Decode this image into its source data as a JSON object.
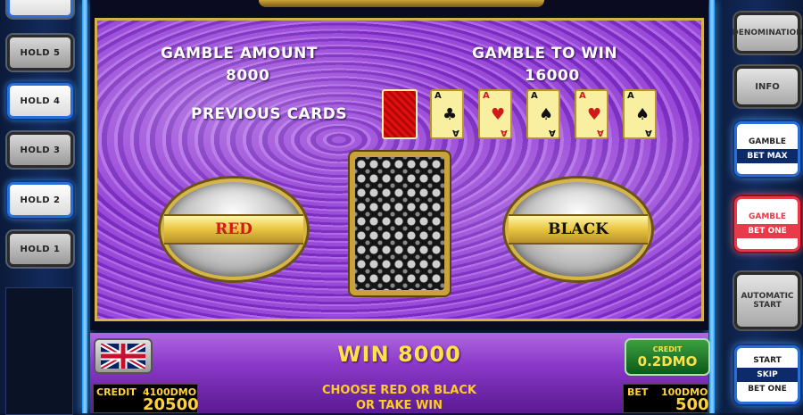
{
  "left_panel": {
    "hold_buttons": [
      {
        "label": "HOLD 5",
        "lit": false
      },
      {
        "label": "HOLD 4",
        "lit": true
      },
      {
        "label": "HOLD 3",
        "lit": false
      },
      {
        "label": "HOLD 2",
        "lit": true
      },
      {
        "label": "HOLD 1",
        "lit": false
      }
    ]
  },
  "right_panel": {
    "denomination_label": "DENOMINATION",
    "info_label": "INFO",
    "gamble_bet_max": {
      "top": "GAMBLE",
      "bottom": "BET MAX"
    },
    "gamble_bet_one": {
      "top": "GAMBLE",
      "bottom": "BET ONE"
    },
    "automatic_start": "AUTOMATIC\nSTART",
    "start_skip_betone": {
      "top": "START",
      "middle": "SKIP",
      "bottom": "BET ONE"
    }
  },
  "gamble": {
    "amount_label": "GAMBLE AMOUNT",
    "amount_value": "8000",
    "to_win_label": "GAMBLE TO WIN",
    "to_win_value": "16000",
    "previous_cards_label": "PREVIOUS CARDS",
    "previous_cards": [
      {
        "rank": "A",
        "suit": "♣",
        "color": "black"
      },
      {
        "rank": "A",
        "suit": "♥",
        "color": "red"
      },
      {
        "rank": "A",
        "suit": "♠",
        "color": "black"
      },
      {
        "rank": "A",
        "suit": "♥",
        "color": "red"
      },
      {
        "rank": "A",
        "suit": "♠",
        "color": "black"
      }
    ],
    "red_label": "RED",
    "black_label": "BLACK"
  },
  "bottom": {
    "win_text": "WIN 8000",
    "prompt_line1": "CHOOSE RED OR BLACK",
    "prompt_line2": "OR TAKE WIN",
    "credit_label": "CREDIT",
    "credit_dmo": "4100DMO",
    "credit_value": "20500",
    "bet_label": "BET",
    "bet_dmo": "100DMO",
    "bet_value": "500",
    "denom_chip_top": "CREDIT",
    "denom_chip_value": "0.2DMO"
  },
  "colors": {
    "accent_gold": "#d4b24a",
    "felt_purple": "#8a3ad0",
    "win_yellow": "#ffe14a",
    "gamble_red": "#e83a4a"
  }
}
